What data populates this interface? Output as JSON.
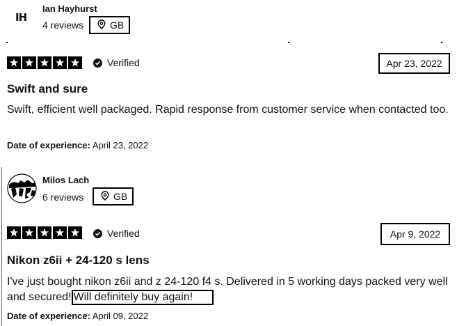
{
  "reviews": [
    {
      "avatar_initials": "IH",
      "name": "Ian Hayhurst",
      "reviews_count": "4 reviews",
      "country": "GB",
      "rating": 5,
      "verified_label": "Verified",
      "date": "Apr 23, 2022",
      "title": "Swift and sure",
      "body": "Swift, efficient well packaged. Rapid response from customer service when contacted too.",
      "experience_label": "Date of experience:",
      "experience_date": "April 23, 2022"
    },
    {
      "name": "Milos Lach",
      "reviews_count": "6 reviews",
      "country": "GB",
      "rating": 5,
      "verified_label": "Verified",
      "date": "Apr 9, 2022",
      "title": "Nikon z6ii + 24-120 s lens",
      "body_main": "I've just bought nikon z6ii and z 24-120 f4 s. Delivered in 5 working days packed very well and secured!",
      "body_highlight": "Will definitely buy again!",
      "experience_label": "Date of experience:",
      "experience_date": "April 09, 2022"
    }
  ],
  "icons": {
    "location": "location-pin-icon",
    "verified": "verified-check-icon",
    "star": "star-icon"
  }
}
